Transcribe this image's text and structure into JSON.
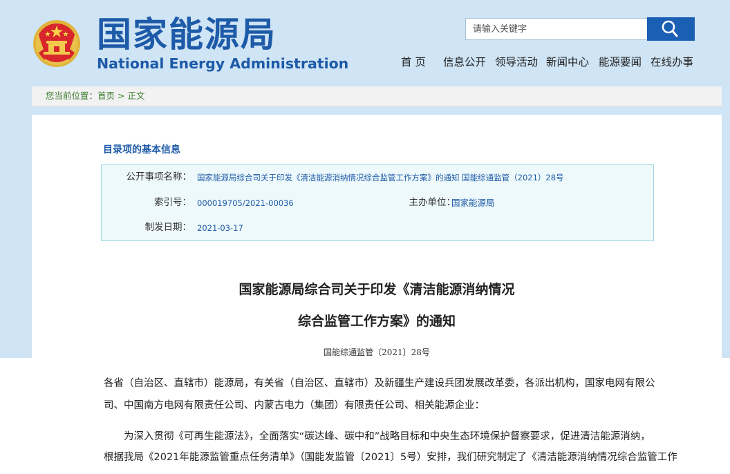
{
  "header": {
    "brand_cn": "国家能源局",
    "brand_en": "National Energy Administration",
    "search_placeholder": "请输入关键字",
    "nav": [
      "首 页",
      "信息公开",
      "领导活动",
      "新闻中心",
      "能源要闻",
      "在线办事"
    ]
  },
  "breadcrumb": {
    "prefix": "您当前位置：",
    "home": "首页",
    "separator": ">",
    "current": "正文"
  },
  "info": {
    "section_title": "目录项的基本信息",
    "subject_label": "公开事项名称：",
    "subject_value": "国家能源局综合司关于印发《清洁能源消纳情况综合监管工作方案》的通知 国能综通监管（2021）28号",
    "index_label": "索引号：",
    "index_value": "000019705/2021-00036",
    "org_label": "主办单位：",
    "org_value": "国家能源局",
    "date_label": "制发日期：",
    "date_value": "2021-03-17"
  },
  "document": {
    "title_line1": "国家能源局综合司关于印发《清洁能源消纳情况",
    "title_line2": "综合监管工作方案》的通知",
    "doc_number": "国能综通监管〔2021〕28号",
    "para1_line1": "各省（自治区、直辖市）能源局，有关省（自治区、直辖市）及新疆生产建设兵团发展改革委，各派出机构，国家电网有限公",
    "para1_line2": "司、中国南方电网有限责任公司、内蒙古电力（集团）有限责任公司、相关能源企业：",
    "para2_line1": "为深入贯彻《可再生能源法》，全面落实“碳达峰、碳中和”战略目标和中央生态环境保护督察要求，促进清洁能源消纳，",
    "para2_line2": "根据我局《2021年能源监管重点任务清单》（国能发监管〔2021〕5号）安排，我们研究制定了《清洁能源消纳情况综合监管工作"
  },
  "colors": {
    "brand_blue": "#1d5aa8",
    "band_blue": "#cfe4f4",
    "search_button": "#1b5fb4",
    "crumb_green": "#3a7a2a",
    "info_bg": "#eef9fb"
  },
  "icons": {
    "emblem": "national-emblem-icon",
    "search": "magnifier-icon"
  }
}
